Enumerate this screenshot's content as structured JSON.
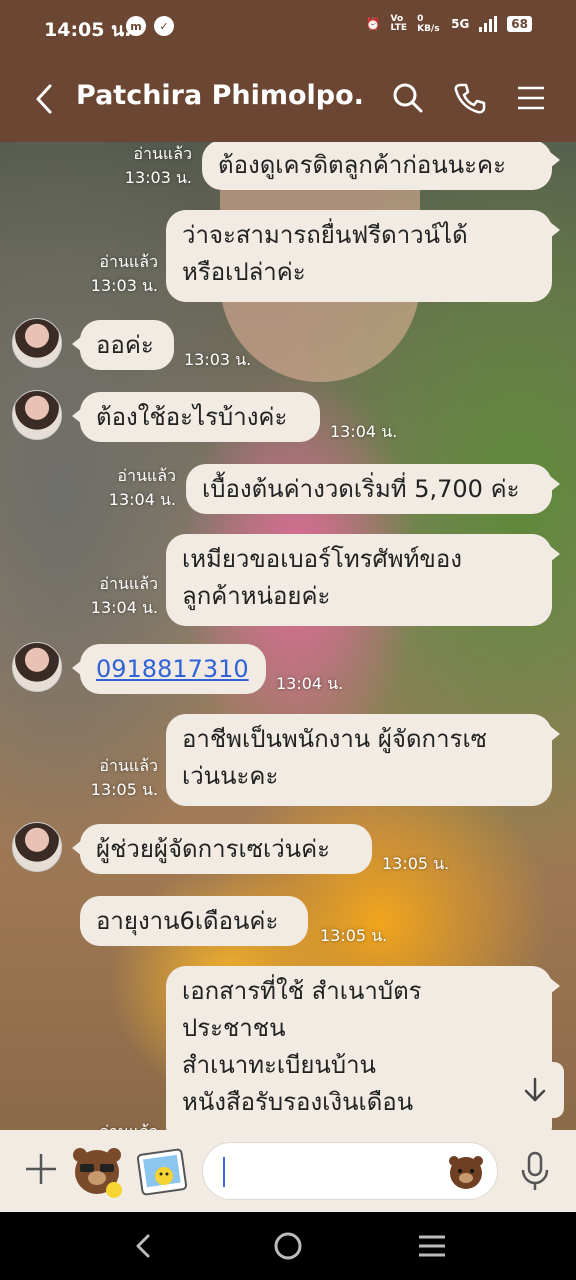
{
  "status_bar": {
    "time": "14:05 น.",
    "network": "5G",
    "battery": "68",
    "data_speed": "0 KB/s"
  },
  "header": {
    "contact_name": "Patchira Phimolpo..."
  },
  "messages": [
    {
      "side": "right",
      "text": "ต้องดูเครดิตลูกค้าก่อนนะคะ",
      "read": "อ่านแล้ว",
      "time": "13:03 น."
    },
    {
      "side": "right",
      "text_lines": [
        "ว่าจะสามารถยื่นฟรีดาวน์ได้",
        "หรือเปล่าค่ะ"
      ],
      "read": "อ่านแล้ว",
      "time": "13:03 น."
    },
    {
      "side": "left",
      "text": "ออค่ะ",
      "time": "13:03 น."
    },
    {
      "side": "left",
      "text": "ต้องใช้อะไรบ้างค่ะ",
      "time": "13:04 น."
    },
    {
      "side": "right",
      "text": "เบื้องต้นค่างวดเริ่มที่ 5,700 ค่ะ",
      "read": "อ่านแล้ว",
      "time": "13:04 น."
    },
    {
      "side": "right",
      "text_lines": [
        "เหมียวขอเบอร์โทรศัพท์ของ",
        "ลูกค้าหน่อยค่ะ"
      ],
      "read": "อ่านแล้ว",
      "time": "13:04 น."
    },
    {
      "side": "left",
      "text": "0918817310",
      "time": "13:04 น."
    },
    {
      "side": "right",
      "text_lines": [
        "อาชีพเป็นพนักงาน ผู้จัดการเซ",
        "เว่นนะคะ"
      ],
      "read": "อ่านแล้ว",
      "time": "13:05 น."
    },
    {
      "side": "left",
      "text": "ผู้ช่วยผู้จัดการเซเว่นค่ะ",
      "time": "13:05 น."
    },
    {
      "side": "left",
      "text": "อายุงาน6เดือนค่ะ",
      "time": "13:05 น."
    },
    {
      "side": "right",
      "text_lines": [
        "เอกสารที่ใช้ สำเนาบัตร",
        "ประชาชน",
        "สำเนาทะเบียนบ้าน",
        "หนังสือรับรองเงินเดือน"
      ],
      "read": "อ่านแล้ว"
    }
  ],
  "colors": {
    "header": "#6b4632",
    "bubble": "#f1ebe4",
    "link": "#2f63d6"
  }
}
